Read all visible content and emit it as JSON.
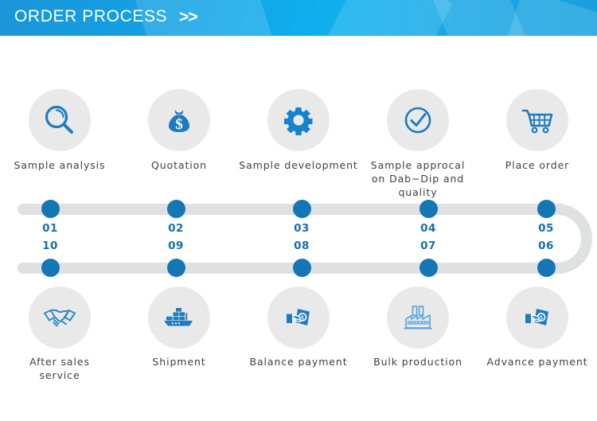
{
  "header": {
    "title": "ORDER PROCESS",
    "chevrons": ">>",
    "bg_color_left": "#1b95d8",
    "bg_color_right": "#0fb0ee",
    "text_color": "#ffffff"
  },
  "theme": {
    "icon_blue": "#1d7cc0",
    "dot_blue": "#1476b4",
    "number_blue": "#1470ad",
    "circle_bg": "#e9e9e9",
    "track_gray": "#dfe0e1",
    "label_color": "#3f3f42"
  },
  "steps_top": [
    {
      "number": "01",
      "label": "Sample analysis",
      "icon": "magnifier-icon"
    },
    {
      "number": "02",
      "label": "Quotation",
      "icon": "money-bag-icon"
    },
    {
      "number": "03",
      "label": "Sample development",
      "icon": "gear-icon"
    },
    {
      "number": "04",
      "label": "Sample approcal\non Dab−Dip and\nquality",
      "icon": "check-circle-icon"
    },
    {
      "number": "05",
      "label": "Place order",
      "icon": "shopping-cart-icon"
    }
  ],
  "steps_bottom": [
    {
      "number": "10",
      "label": "After sales\nservice",
      "icon": "handshake-icon"
    },
    {
      "number": "09",
      "label": "Shipment",
      "icon": "cargo-ship-icon"
    },
    {
      "number": "08",
      "label": "Balance payment",
      "icon": "cash-hand-icon"
    },
    {
      "number": "07",
      "label": "Bulk production",
      "icon": "factory-icon"
    },
    {
      "number": "06",
      "label": "Advance payment",
      "icon": "cash-hand-icon"
    }
  ]
}
